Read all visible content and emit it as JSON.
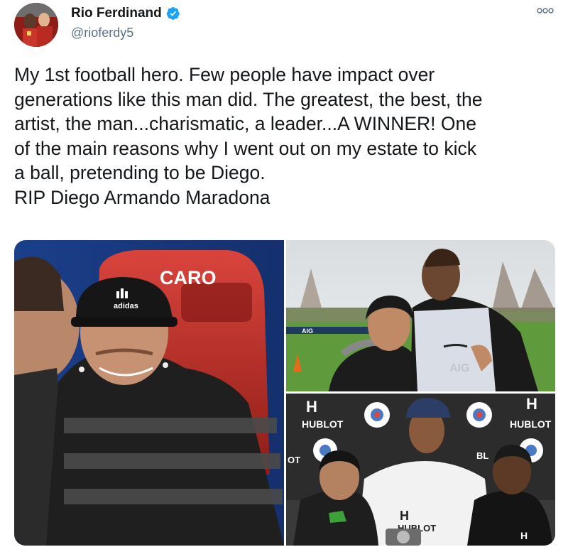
{
  "tweet": {
    "display_name": "Rio Ferdinand",
    "handle": "@rioferdy5",
    "verified": true,
    "text": "My 1st football hero. Few people have impact over\ngenerations like this man did. The greatest, the best, the\nartist, the man...charismatic, a leader...A WINNER! One\nof the main reasons why I went out on my estate to kick\na ball, pretending to be Diego.\nRIP Diego Armando Maradona"
  },
  "media": {
    "photo1": {
      "seat_text": "CARO",
      "cap_logo": "adidas"
    },
    "photo2": {
      "board_text": "AIG",
      "bib_text": "AIG"
    },
    "photo3": {
      "brand_left": "HUBLOT",
      "brand_right": "HUBLOT",
      "brand_partial": "OT",
      "brand_center": "BL",
      "shirt_brand": "HUBLOT",
      "hublot_mark": "H"
    }
  },
  "colors": {
    "verified": "#1da1f2",
    "handle": "#5b7083",
    "text": "#14171a"
  },
  "icons": {
    "verified": "verified-badge-icon",
    "more": "more-options-icon"
  }
}
